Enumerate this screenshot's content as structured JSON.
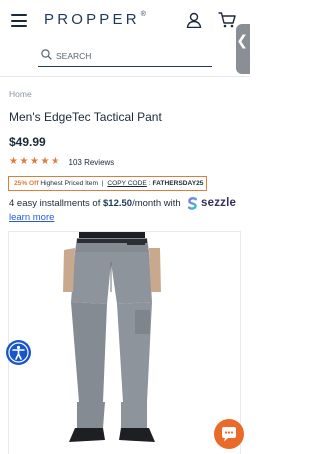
{
  "header": {
    "logo": "PROPPER",
    "logo_mark": "®",
    "icons": [
      "menu-icon",
      "account-icon",
      "cart-icon"
    ]
  },
  "search": {
    "placeholder": "SEARCH"
  },
  "breadcrumb": "Home",
  "product": {
    "title": "Men's EdgeTec Tactical Pant",
    "price": "$49.99",
    "rating": 4.5,
    "reviews": "103 Reviews"
  },
  "promo": {
    "percent": "25% Off",
    "text": "Highest Priced Item",
    "separator": "|",
    "code_label": "COPY CODE",
    "code_sep": ":",
    "code": "FATHERSDAY25"
  },
  "installments": {
    "prefix": "4 easy installments of",
    "amount": "$12.50",
    "suffix": "/month with",
    "provider": "sezzle",
    "learn_more": "learn more"
  },
  "colors": {
    "accent": "#e07b39",
    "brand": "#1d3a5a",
    "link": "#2a5bd7",
    "accessibility": "#1a56c8",
    "chat": "#ea6a2a"
  }
}
